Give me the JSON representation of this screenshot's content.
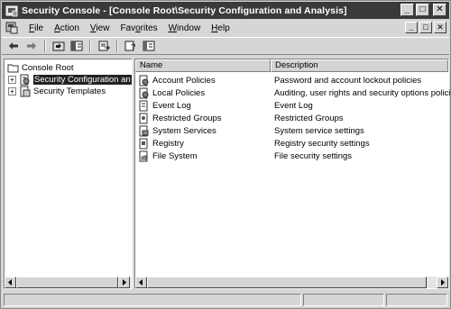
{
  "window": {
    "title": "Security Console - [Console Root\\Security Configuration and Analysis]",
    "title_bg": "#3a3a3a"
  },
  "caption_buttons": [
    "_",
    "□",
    "✕"
  ],
  "menu": {
    "items": [
      {
        "label": "File",
        "accel": "F"
      },
      {
        "label": "Action",
        "accel": "A"
      },
      {
        "label": "View",
        "accel": "V"
      },
      {
        "label": "Favorites",
        "accel": "o"
      },
      {
        "label": "Window",
        "accel": "W"
      },
      {
        "label": "Help",
        "accel": "H"
      }
    ]
  },
  "toolbar": {
    "buttons": [
      "back-arrow-icon",
      "forward-arrow-icon",
      "up-folder-icon",
      "show-hide-tree-icon",
      "export-list-icon",
      "help-icon",
      "properties-icon"
    ]
  },
  "tree": {
    "root": "Console Root",
    "items": [
      {
        "label": "Security Configuration an",
        "selected": true
      },
      {
        "label": "Security Templates",
        "selected": false
      }
    ]
  },
  "list": {
    "columns": [
      "Name",
      "Description"
    ],
    "rows": [
      {
        "name": "Account Policies",
        "description": "Password and account lockout policies"
      },
      {
        "name": "Local Policies",
        "description": "Auditing, user rights and security options policies"
      },
      {
        "name": "Event Log",
        "description": "Event Log"
      },
      {
        "name": "Restricted Groups",
        "description": "Restricted Groups"
      },
      {
        "name": "System Services",
        "description": "System service settings"
      },
      {
        "name": "Registry",
        "description": "Registry security settings"
      },
      {
        "name": "File System",
        "description": "File security settings"
      }
    ]
  }
}
